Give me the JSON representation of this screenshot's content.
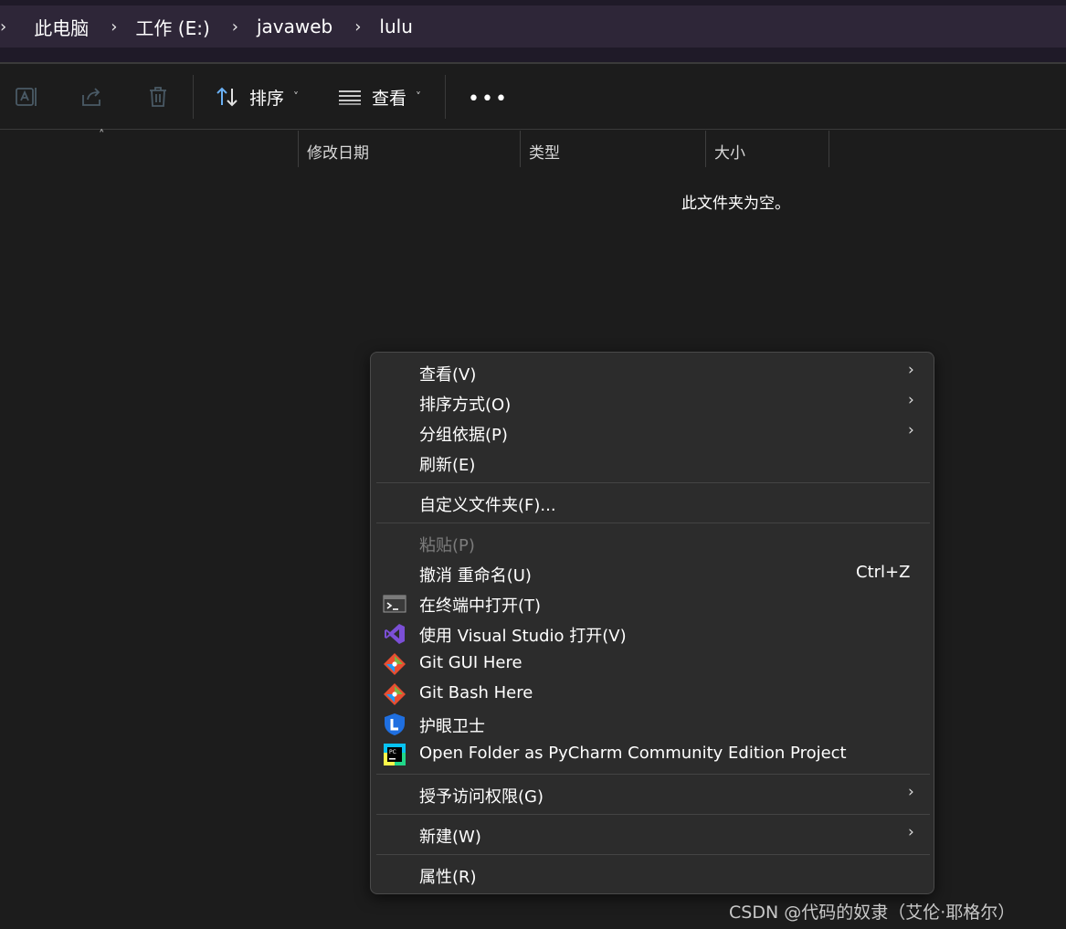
{
  "breadcrumb": {
    "items": [
      "此电脑",
      "工作 (E:)",
      "javaweb",
      "lulu"
    ]
  },
  "toolbar": {
    "rename_icon": "rename-icon",
    "share_icon": "share-icon",
    "delete_icon": "delete-icon",
    "sort_label": "排序",
    "view_label": "查看",
    "more_label": "•••"
  },
  "columns": [
    "修改日期",
    "类型",
    "大小"
  ],
  "empty_message": "此文件夹为空。",
  "context_menu": {
    "view": "查看(V)",
    "sort_by": "排序方式(O)",
    "group_by": "分组依据(P)",
    "refresh": "刷新(E)",
    "customize": "自定义文件夹(F)...",
    "paste": "粘贴(P)",
    "undo_rename": "撤消 重命名(U)",
    "undo_shortcut": "Ctrl+Z",
    "open_terminal": "在终端中打开(T)",
    "open_vs": "使用 Visual Studio 打开(V)",
    "git_gui": "Git GUI Here",
    "git_bash": "Git Bash Here",
    "eye_guard": "护眼卫士",
    "pycharm": "Open Folder as PyCharm Community Edition Project",
    "grant_access": "授予访问权限(G)",
    "new": "新建(W)",
    "properties": "属性(R)"
  },
  "watermark": "CSDN @代码的奴隶（艾伦·耶格尔）",
  "colors": {
    "background": "#1c1c1c",
    "breadcrumb_bg": "#2e2638",
    "menu_bg": "#2c2c2c",
    "vs_purple": "#7b4fd6",
    "git_orange": "#e84e31",
    "shield_blue": "#1f6fe0"
  }
}
